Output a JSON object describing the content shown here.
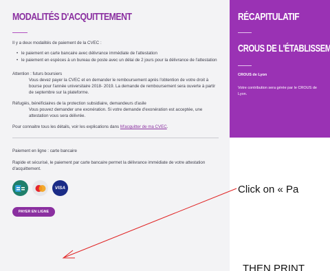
{
  "left": {
    "title": "MODALITÉS D'ACQUITTEMENT",
    "intro": "Il y a deux modalités de paiement de la CVEC :",
    "bullets": [
      "le paiement en carte bancaire avec délivrance immédiate de l'attestation",
      "le paiement en espèces à un bureau de poste avec un délai de 2 jours pour la délivrance de l'attestation"
    ],
    "attention_label": "Attention : futurs boursiers",
    "attention_text": "Vous devez payer la CVEC et en demander le remboursement après l'obtention de votre droit à bourse pour l'année universitaire 2018- 2019. La demande de remboursement sera ouverte à partir de septembre sur la plateforme.",
    "refugees_label": "Réfugiés, bénéficiaires de la protection subsidiaire, demandeurs d'asile",
    "refugees_text": "Vous pouvez demander une exonération. Si votre demande d'exonération est acceptée, une attestation vous sera délivrée.",
    "details_prefix": "Pour connaitre tous les détails, voir les explications dans ",
    "details_link": "M'acquitter de ma CVEC",
    "details_suffix": ".",
    "online_title": "Paiement en ligne : carte bancaire",
    "online_text": "Rapide et sécurisé, le paiement par carte bancaire permet la délivrance immédiate de votre attestation d'acquittement.",
    "card_icons": [
      "cb-card-icon",
      "mastercard-icon",
      "visa-card-icon"
    ],
    "visa_label": "VISA",
    "pay_button": "PAYER EN LIGNE"
  },
  "right": {
    "title": "RÉCAPITULATIF",
    "subtitle": "CROUS DE L'ÉTABLISSEMENT",
    "crous_name": "CROUS de Lyon",
    "contribution_text": "Votre contribution sera gérée par le CROUS de",
    "contribution_text_2": "Lyon."
  },
  "annotations": {
    "click_note": "Click on « Pa",
    "then_print": "THEN PRINT"
  },
  "colors": {
    "accent": "#8a2fa0",
    "right_panel": "#9a32b4",
    "left_panel": "#f3f3f5",
    "arrow": "#e02020"
  }
}
